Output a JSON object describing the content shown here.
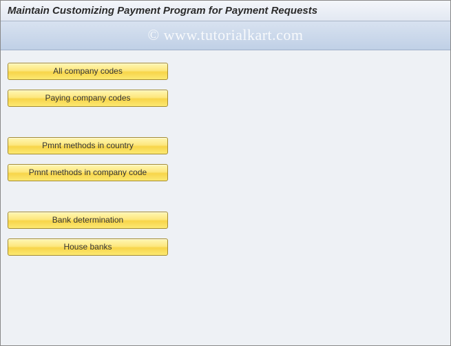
{
  "header": {
    "title": "Maintain Customizing Payment Program for Payment Requests"
  },
  "buttons": {
    "all_company_codes": "All company codes",
    "paying_company_codes": "Paying company codes",
    "pmnt_methods_country": "Pmnt methods in country",
    "pmnt_methods_company": "Pmnt methods in company code",
    "bank_determination": "Bank determination",
    "house_banks": "House banks"
  },
  "watermark": "© www.tutorialkart.com"
}
